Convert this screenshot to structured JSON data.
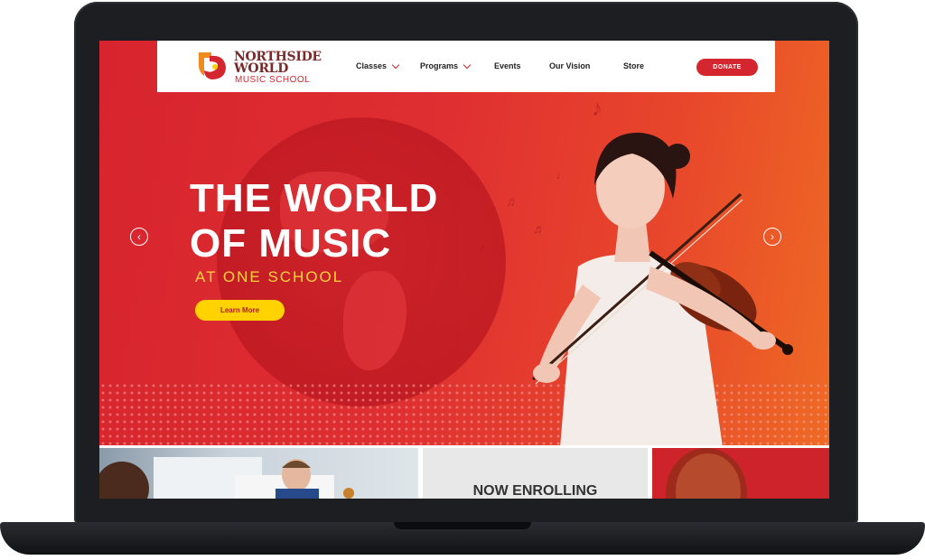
{
  "brand": {
    "name_line1": "NORTHSIDE",
    "name_line2": "WORLD",
    "name_line3": "MUSIC SCHOOL"
  },
  "nav": {
    "items": [
      {
        "label": "Classes",
        "has_dropdown": true
      },
      {
        "label": "Programs",
        "has_dropdown": true
      },
      {
        "label": "Events",
        "has_dropdown": false
      },
      {
        "label": "Our Vision",
        "has_dropdown": false
      },
      {
        "label": "Store",
        "has_dropdown": false
      }
    ],
    "donate_label": "DONATE"
  },
  "hero": {
    "headline_line1": "THE WORLD",
    "headline_line2": "OF MUSIC",
    "subheadline": "AT ONE SCHOOL",
    "cta_label": "Learn More",
    "prev_icon": "chevron-left-icon",
    "next_icon": "chevron-right-icon"
  },
  "tiles": {
    "middle_label": "NOW ENROLLING"
  },
  "colors": {
    "brand_red": "#d4262f",
    "accent_yellow": "#ffd200",
    "hero_orange": "#ee6a24"
  }
}
